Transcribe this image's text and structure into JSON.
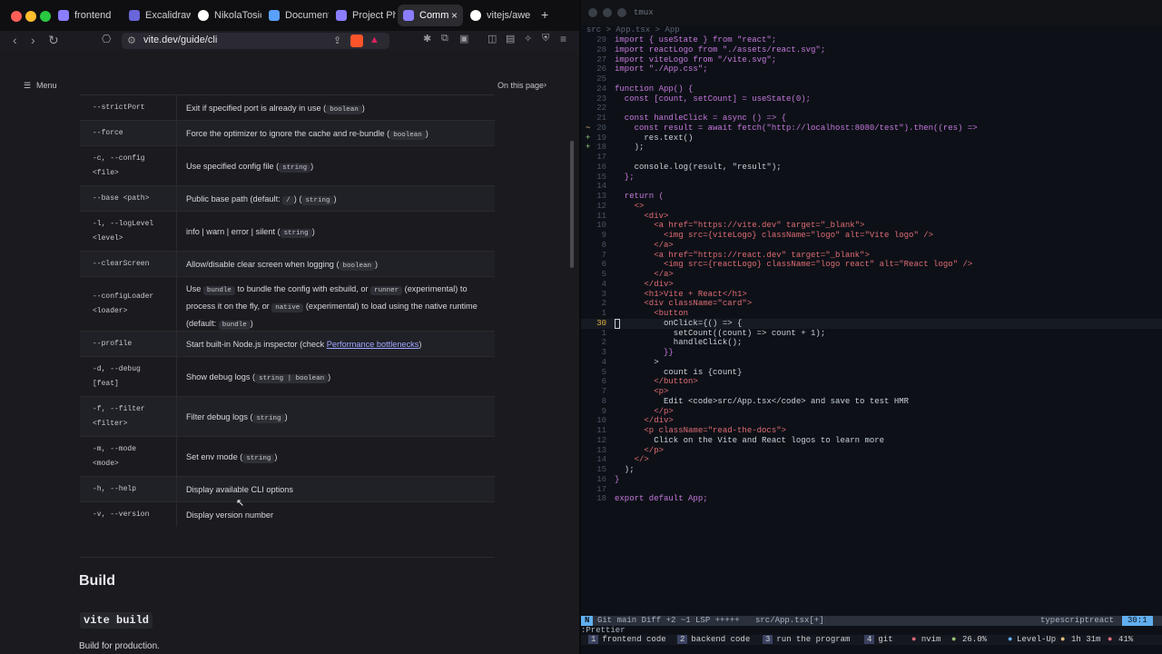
{
  "browser": {
    "tabs": [
      {
        "label": "frontend",
        "icon": "vite-icon"
      },
      {
        "label": "Excalidraw",
        "icon": "excalidraw-icon"
      },
      {
        "label": "NikolaTosic",
        "icon": "github-icon"
      },
      {
        "label": "Documentat",
        "icon": "doc-icon"
      },
      {
        "label": "Project Ph",
        "icon": "vite-icon"
      },
      {
        "label": "Comm",
        "icon": "vite-icon"
      },
      {
        "label": "vitejs/awe",
        "icon": "github-icon"
      }
    ],
    "new_tab": "+",
    "close_tab": "×",
    "url": "vite.dev/guide/cli",
    "shield_count": "10"
  },
  "page": {
    "menu_label": "Menu",
    "on_this_page": "On this page",
    "rows": [
      {
        "opt": "--strictPort",
        "desc": [
          "Exit if specified port is already in use (",
          {
            "code": "boolean"
          },
          ")"
        ]
      },
      {
        "opt": "--force",
        "desc": [
          "Force the optimizer to ignore the cache and re-bundle (",
          {
            "code": "boolean"
          },
          ")"
        ]
      },
      {
        "opt": "-c, --config <file>",
        "desc": [
          "Use specified config file (",
          {
            "code": "string"
          },
          ")"
        ]
      },
      {
        "opt": "--base <path>",
        "desc": [
          "Public base path (default: ",
          {
            "code": "/"
          },
          ") (",
          {
            "code": "string"
          },
          ")"
        ]
      },
      {
        "opt": "-l, --logLevel <level>",
        "desc": [
          "info | warn | error | silent (",
          {
            "code": "string"
          },
          ")"
        ]
      },
      {
        "opt": "--clearScreen",
        "desc": [
          "Allow/disable clear screen when logging (",
          {
            "code": "boolean"
          },
          ")"
        ]
      },
      {
        "opt": "--configLoader <loader>",
        "desc": [
          "Use ",
          {
            "code": "bundle"
          },
          " to bundle the config with esbuild, or ",
          {
            "code": "runner"
          },
          " (experimental) to process it on the fly, or ",
          {
            "code": "native"
          },
          " (experimental) to load using the native runtime (default: ",
          {
            "code": "bundle"
          },
          ")"
        ]
      },
      {
        "opt": "--profile",
        "desc": [
          "Start built-in Node.js inspector (check ",
          {
            "link": "Performance bottlenecks"
          },
          ")"
        ]
      },
      {
        "opt": "-d, --debug [feat]",
        "desc": [
          "Show debug logs (",
          {
            "code": "string | boolean"
          },
          ")"
        ]
      },
      {
        "opt": "-f, --filter <filter>",
        "desc": [
          "Filter debug logs (",
          {
            "code": "string"
          },
          ")"
        ]
      },
      {
        "opt": "-m, --mode <mode>",
        "desc": [
          "Set env mode (",
          {
            "code": "string"
          },
          ")"
        ]
      },
      {
        "opt": "-h, --help",
        "desc": [
          "Display available CLI options"
        ]
      },
      {
        "opt": "-v, --version",
        "desc": [
          "Display version number"
        ]
      }
    ],
    "build_heading": "Build",
    "build_cmd": "vite build",
    "build_text": "Build for production."
  },
  "terminal": {
    "title": "tmux",
    "breadcrumb": "src > App.tsx > App",
    "statusline": {
      "mode": "N",
      "git": "Git main Diff +2 ~1 LSP +++++",
      "file": "src/App.tsx[+]",
      "filetype": "typescriptreact",
      "pos": "30:1"
    },
    "cmdline": ":Prettier",
    "tmux": [
      {
        "num": "1",
        "label": "frontend code"
      },
      {
        "num": "2",
        "label": "backend code"
      },
      {
        "num": "3",
        "label": "run the program"
      },
      {
        "num": "4",
        "label": "git"
      },
      {
        "num": "",
        "label": "nvim"
      }
    ],
    "tmux_right": {
      "cpu": "26.0%",
      "level": "Level-Up",
      "time": "1h 31m",
      "battery": "41%"
    },
    "code_lines": [
      {
        "n": "29",
        "t": "import { useState } from \"react\";"
      },
      {
        "n": "28",
        "t": "import reactLogo from \"./assets/react.svg\";"
      },
      {
        "n": "27",
        "t": "import viteLogo from \"/vite.svg\";"
      },
      {
        "n": "26",
        "t": "import \"./App.css\";"
      },
      {
        "n": "25",
        "t": ""
      },
      {
        "n": "24",
        "t": "function App() {"
      },
      {
        "n": "23",
        "t": "  const [count, setCount] = useState(0);"
      },
      {
        "n": "22",
        "t": ""
      },
      {
        "n": "21",
        "t": "  const handleClick = async () => {"
      },
      {
        "n": "20",
        "t": "    const result = await fetch(\"http://localhost:8080/test\").then((res) =>"
      },
      {
        "n": "19",
        "t": "      res.text()"
      },
      {
        "n": "18",
        "t": "    );"
      },
      {
        "n": "17",
        "t": ""
      },
      {
        "n": "16",
        "t": "    console.log(result, \"result\");"
      },
      {
        "n": "15",
        "t": "  };"
      },
      {
        "n": "14",
        "t": ""
      },
      {
        "n": "13",
        "t": "  return ("
      },
      {
        "n": "12",
        "t": "    <>"
      },
      {
        "n": "11",
        "t": "      <div>"
      },
      {
        "n": "10",
        "t": "        <a href=\"https://vite.dev\" target=\"_blank\">"
      },
      {
        "n": "9",
        "t": "          <img src={viteLogo} className=\"logo\" alt=\"Vite logo\" />"
      },
      {
        "n": "8",
        "t": "        </a>"
      },
      {
        "n": "7",
        "t": "        <a href=\"https://react.dev\" target=\"_blank\">"
      },
      {
        "n": "6",
        "t": "          <img src={reactLogo} className=\"logo react\" alt=\"React logo\" />"
      },
      {
        "n": "5",
        "t": "        </a>"
      },
      {
        "n": "4",
        "t": "      </div>"
      },
      {
        "n": "3",
        "t": "      <h1>Vite + React</h1>"
      },
      {
        "n": "2",
        "t": "      <div className=\"card\">"
      },
      {
        "n": "1",
        "t": "        <button"
      },
      {
        "n": "30",
        "t": "          onClick={() => {"
      },
      {
        "n": "1",
        "t": "            setCount((count) => count + 1);"
      },
      {
        "n": "2",
        "t": "            handleClick();"
      },
      {
        "n": "3",
        "t": "          }}"
      },
      {
        "n": "4",
        "t": "        >"
      },
      {
        "n": "5",
        "t": "          count is {count}"
      },
      {
        "n": "6",
        "t": "        </button>"
      },
      {
        "n": "7",
        "t": "        <p>"
      },
      {
        "n": "8",
        "t": "          Edit <code>src/App.tsx</code> and save to test HMR"
      },
      {
        "n": "9",
        "t": "        </p>"
      },
      {
        "n": "10",
        "t": "      </div>"
      },
      {
        "n": "11",
        "t": "      <p className=\"read-the-docs\">"
      },
      {
        "n": "12",
        "t": "        Click on the Vite and React logos to learn more"
      },
      {
        "n": "13",
        "t": "      </p>"
      },
      {
        "n": "14",
        "t": "    </>"
      },
      {
        "n": "15",
        "t": "  );"
      },
      {
        "n": "16",
        "t": "}"
      },
      {
        "n": "17",
        "t": ""
      },
      {
        "n": "18",
        "t": "export default App;"
      }
    ]
  },
  "colors": {
    "accent": "#a0a8ff",
    "cursorline": "#e3b341"
  }
}
